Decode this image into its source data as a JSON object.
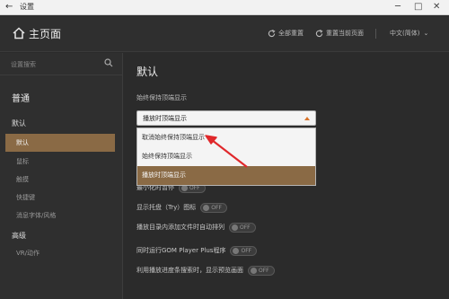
{
  "titlebar": {
    "back_glyph": "←",
    "title": "设置",
    "min_glyph": "─",
    "max_glyph": "□",
    "close_glyph": "✕"
  },
  "header": {
    "home_title": "主页面",
    "reset_all": "全部重置",
    "reset_page": "重置当前页面",
    "language": "中文(简体)",
    "language_caret": "⌄"
  },
  "sidebar": {
    "search_placeholder": "设置搜索",
    "heading": "普通",
    "section_default": "默认",
    "items": [
      {
        "label": "默认",
        "active": true
      },
      {
        "label": "鼠标",
        "active": false
      },
      {
        "label": "触摸",
        "active": false
      },
      {
        "label": "快捷键",
        "active": false
      },
      {
        "label": "消息字体/风格",
        "active": false
      }
    ],
    "section_advanced": "高级",
    "advanced_items": [
      {
        "label": "VR/动作"
      }
    ]
  },
  "main": {
    "page_title": "默认",
    "field_label": "始终保持顶端显示",
    "select_value": "播放时顶端显示",
    "dropdown_options": [
      {
        "label": "取消始终保持顶端显示",
        "selected": false
      },
      {
        "label": "始终保持顶端显示",
        "selected": false
      },
      {
        "label": "播放时顶端显示",
        "selected": true
      }
    ],
    "rows": [
      {
        "label": "最小化时暂停",
        "toggle": "OFF"
      },
      {
        "label": "显示托盘（Try）图标",
        "toggle": "OFF"
      },
      {
        "label": "播放目录内添加文件时自动排列",
        "toggle": "OFF"
      },
      {
        "label": "同时运行GOM Player Plus程序",
        "toggle": "OFF"
      },
      {
        "label": "利用播放进度条搜索时，显示预览画面",
        "toggle": "OFF"
      }
    ]
  },
  "colors": {
    "accent": "#8a6a45",
    "arrow": "#e0282b",
    "caret": "#d9742a"
  }
}
